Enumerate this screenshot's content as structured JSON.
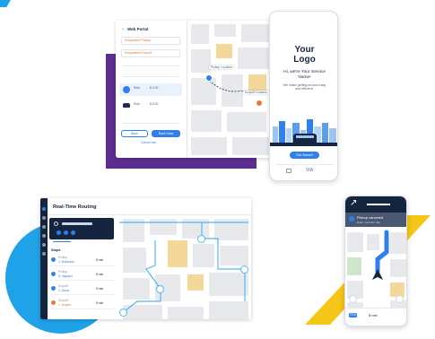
{
  "web_portal": {
    "title": "Web Portal",
    "pickup_field": "Requested Pickup",
    "dropoff_field": "Requested Dropoff",
    "section_label": "",
    "ride_options": [
      {
        "label": "Ride",
        "value": "$ 4.00"
      },
      {
        "label": "Ride",
        "value": "$ 5.00"
      }
    ],
    "back_button": "Back",
    "book_button": "Book Now",
    "footer_link": "Cancel ride",
    "pickup_tag": "Pickup Location",
    "dropoff_tag": "Dropoff Location"
  },
  "phone_splash": {
    "logo_line1": "Your",
    "logo_line2": "Logo",
    "greeting": "Hi, we're Your Service Name!",
    "subtitle": "We make getting around easy and efficient.",
    "cta_button": "Get Started",
    "footer_brand": "VIA"
  },
  "routing": {
    "title": "Real-Time Routing",
    "stops_header": "Stops",
    "stops": [
      {
        "type": "Pickup",
        "name": "J. Robinson",
        "time": "8 min",
        "color": "#2f80ed"
      },
      {
        "type": "Pickup",
        "name": "A. Nguyen",
        "time": "8 min",
        "color": "#2f80ed"
      },
      {
        "type": "Dropoff",
        "name": "J. Davis",
        "time": "9 min",
        "color": "#2f80ed"
      },
      {
        "type": "Dropoff",
        "name": "L. Angelo",
        "time": "6 min",
        "color": "#e07b39"
      }
    ]
  },
  "driver_app": {
    "banner_title": "Pickup canceled",
    "banner_sub": "Rider canceled ride",
    "bottom_label": "8 min",
    "bottom_tag": "ETA"
  },
  "colors": {
    "accent": "#2f80ed",
    "purple": "#5b2d90",
    "cyan": "#1fa2e8",
    "yellow": "#f5c518",
    "navy": "#16253f",
    "orange": "#e07b39"
  },
  "icons": [
    "check-icon",
    "pin-icon",
    "car-icon",
    "chevron-right-icon",
    "navigation-arrow-icon",
    "bus-icon",
    "search-icon"
  ]
}
